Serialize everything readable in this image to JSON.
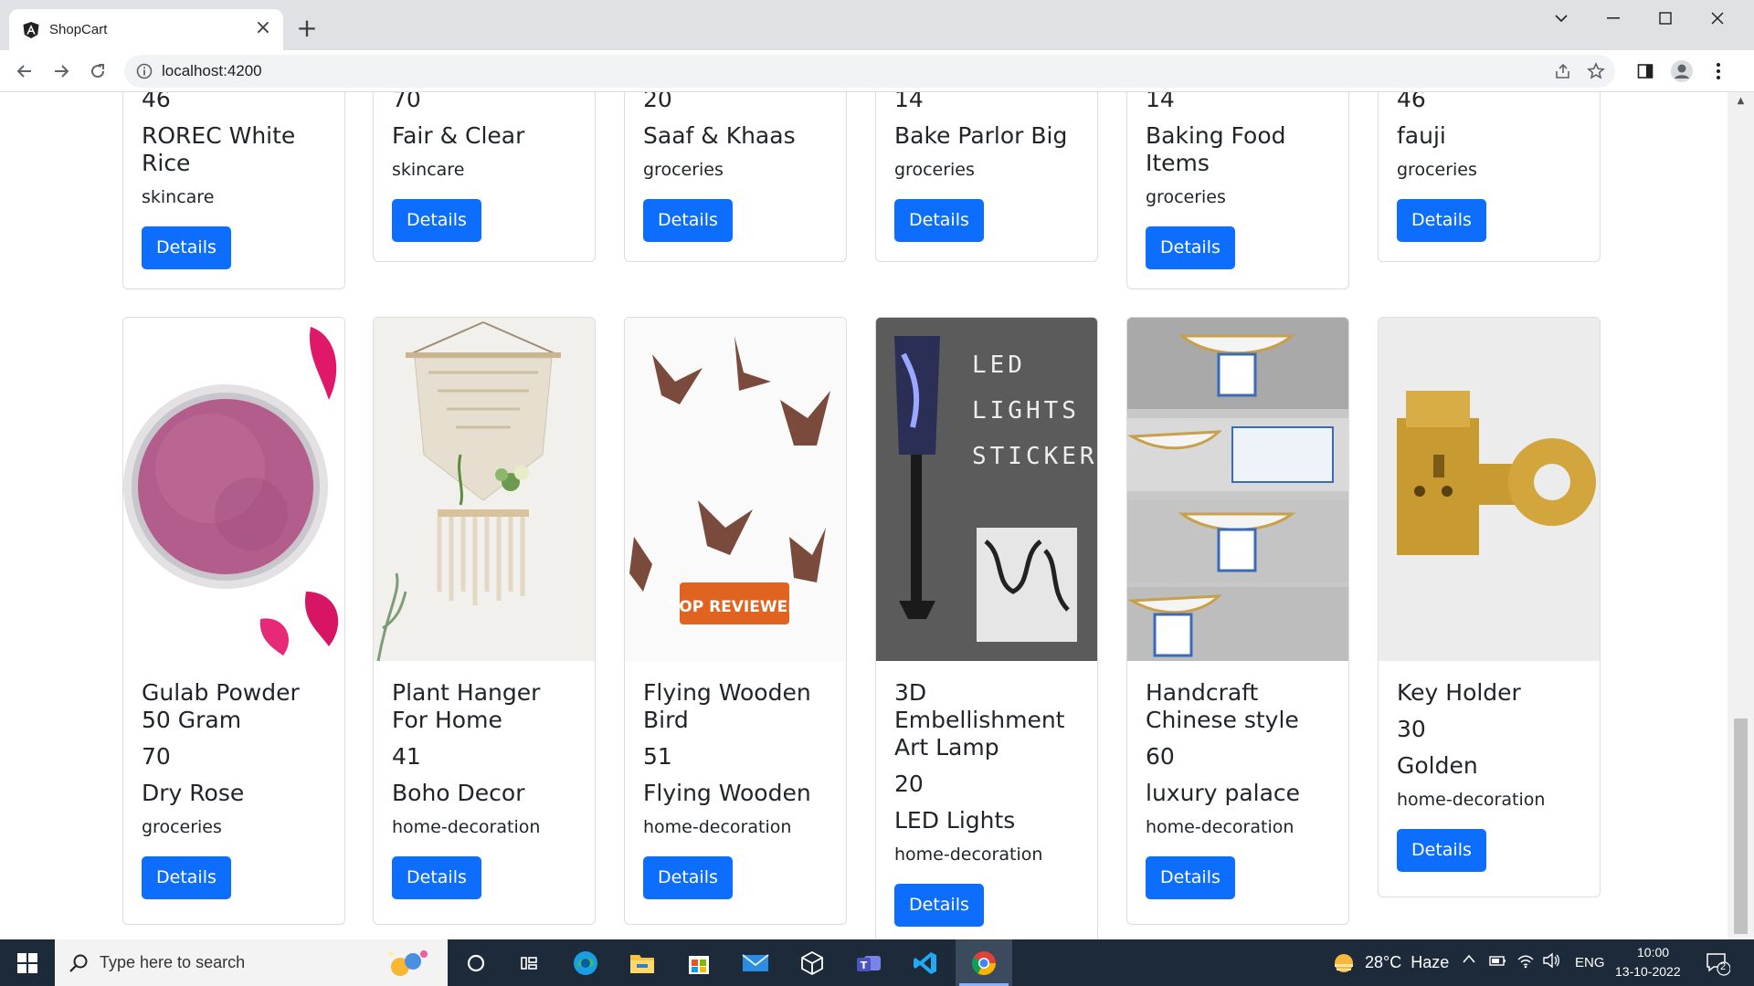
{
  "browser": {
    "tab_title": "ShopCart",
    "url": "localhost:4200"
  },
  "products_top": [
    {
      "price": "46",
      "title": "ROREC White Rice",
      "category": "skincare",
      "button": "Details"
    },
    {
      "price": "70",
      "title": "Fair & Clear",
      "category": "skincare",
      "button": "Details"
    },
    {
      "price": "20",
      "title": "Saaf & Khaas",
      "category": "groceries",
      "button": "Details"
    },
    {
      "price": "14",
      "title": "Bake Parlor Big",
      "category": "groceries",
      "button": "Details"
    },
    {
      "price": "14",
      "title": "Baking Food Items",
      "category": "groceries",
      "button": "Details"
    },
    {
      "price": "46",
      "title": "fauji",
      "category": "groceries",
      "button": "Details"
    }
  ],
  "products": [
    {
      "title": "Gulab Powder 50 Gram",
      "price": "70",
      "brand": "Dry Rose",
      "category": "groceries",
      "button": "Details",
      "image": "rose-powder-image"
    },
    {
      "title": "Plant Hanger For Home",
      "price": "41",
      "brand": "Boho Decor",
      "category": "home-decoration",
      "button": "Details",
      "image": "macrame-plant-hanger-image"
    },
    {
      "title": "Flying Wooden Bird",
      "price": "51",
      "brand": "Flying Wooden",
      "category": "home-decoration",
      "button": "Details",
      "image": "wooden-birds-image",
      "image_badge": "TOP REVIEWED"
    },
    {
      "title": "3D Embellishment Art Lamp",
      "price": "20",
      "brand": "LED Lights",
      "category": "home-decoration",
      "button": "Details",
      "image": "led-lamp-image",
      "image_text": [
        "LED",
        "LIGHTS",
        "STICKERS"
      ]
    },
    {
      "title": "Handcraft Chinese style",
      "price": "60",
      "brand": "luxury palace",
      "category": "home-decoration",
      "button": "Details",
      "image": "chinese-bowls-image"
    },
    {
      "title": "Key Holder",
      "price": "30",
      "brand": "Golden",
      "category": "home-decoration",
      "button": "Details",
      "image": "golden-key-holder-image"
    }
  ],
  "taskbar": {
    "search_placeholder": "Type here to search",
    "weather": "28°C  Haze",
    "language": "ENG",
    "time": "10:00",
    "date": "13-10-2022",
    "notification_count": "2"
  },
  "colors": {
    "primary_button": "#0d6efd",
    "taskbar": "#1c2a3a",
    "titlebar": "#dfe1e5"
  }
}
